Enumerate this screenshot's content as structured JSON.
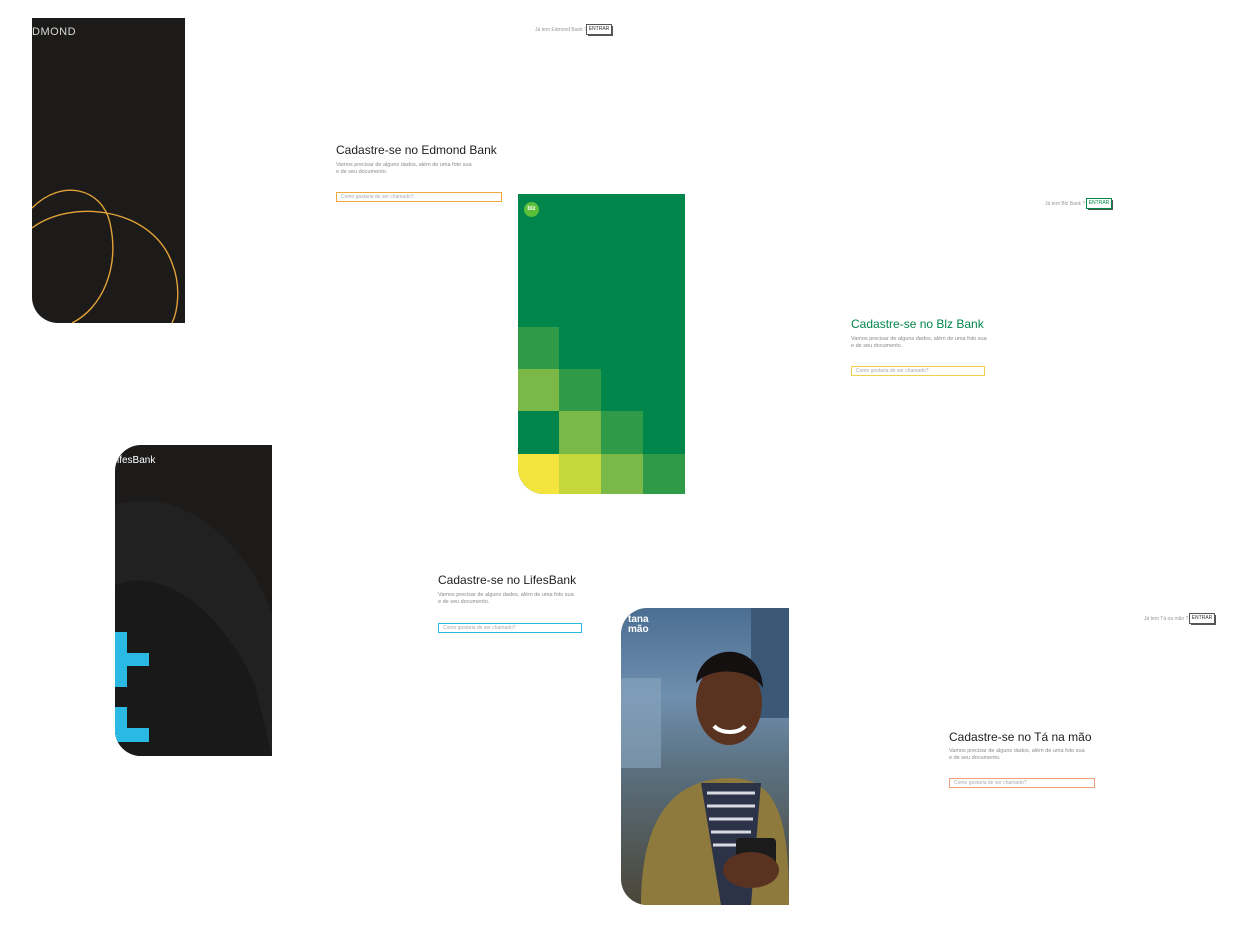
{
  "screens": [
    {
      "id": "edmond",
      "logo": "DMOND",
      "logo_o_accent": "O",
      "have_account": "Já tem Edmond Bank ?",
      "login": "ENTRAR",
      "title": "Cadastre-se no Edmond Bank",
      "subtitle_1": "Vamos precisar de alguns dados, além de uma foto sua",
      "subtitle_2": "e de seu documento.",
      "input_placeholder": "Como gostaria de ser chamado?",
      "accent": "#f2a93b",
      "panel": "#1c1b1a"
    },
    {
      "id": "blz",
      "logo": "blz",
      "have_account": "Já tem Blz Bank ?",
      "login": "ENTRAR",
      "title": "Cadastre-se no Blz Bank",
      "subtitle_1": "Vamos precisar de alguns dados, além de uma foto sua",
      "subtitle_2": "e de seu documento.",
      "input_placeholder": "Como gostaria de ser chamado?",
      "accent": "#f2d04b",
      "brand": "#00864b"
    },
    {
      "id": "lifes",
      "logo": "ifesBank",
      "title": "Cadastre-se no LifesBank",
      "subtitle_1": "Vamos precisar de alguns dados, além de uma foto sua",
      "subtitle_2": "e de seu documento.",
      "input_placeholder": "Como gostaria de ser chamado?",
      "accent": "#29b9e3",
      "panel": "#1c1b1a"
    },
    {
      "id": "tanamao",
      "logo_1": "tana",
      "logo_2": "mão",
      "have_account": "Já tem Tá na mão ?",
      "login": "ENTRAR",
      "title": "Cadastre-se no Tá na mão",
      "subtitle_1": "Vamos precisar de alguns dados, além de uma foto sua",
      "subtitle_2": "e de seu documento.",
      "input_placeholder": "Como gostaria de ser chamado?",
      "accent": "#f2a07b"
    }
  ]
}
